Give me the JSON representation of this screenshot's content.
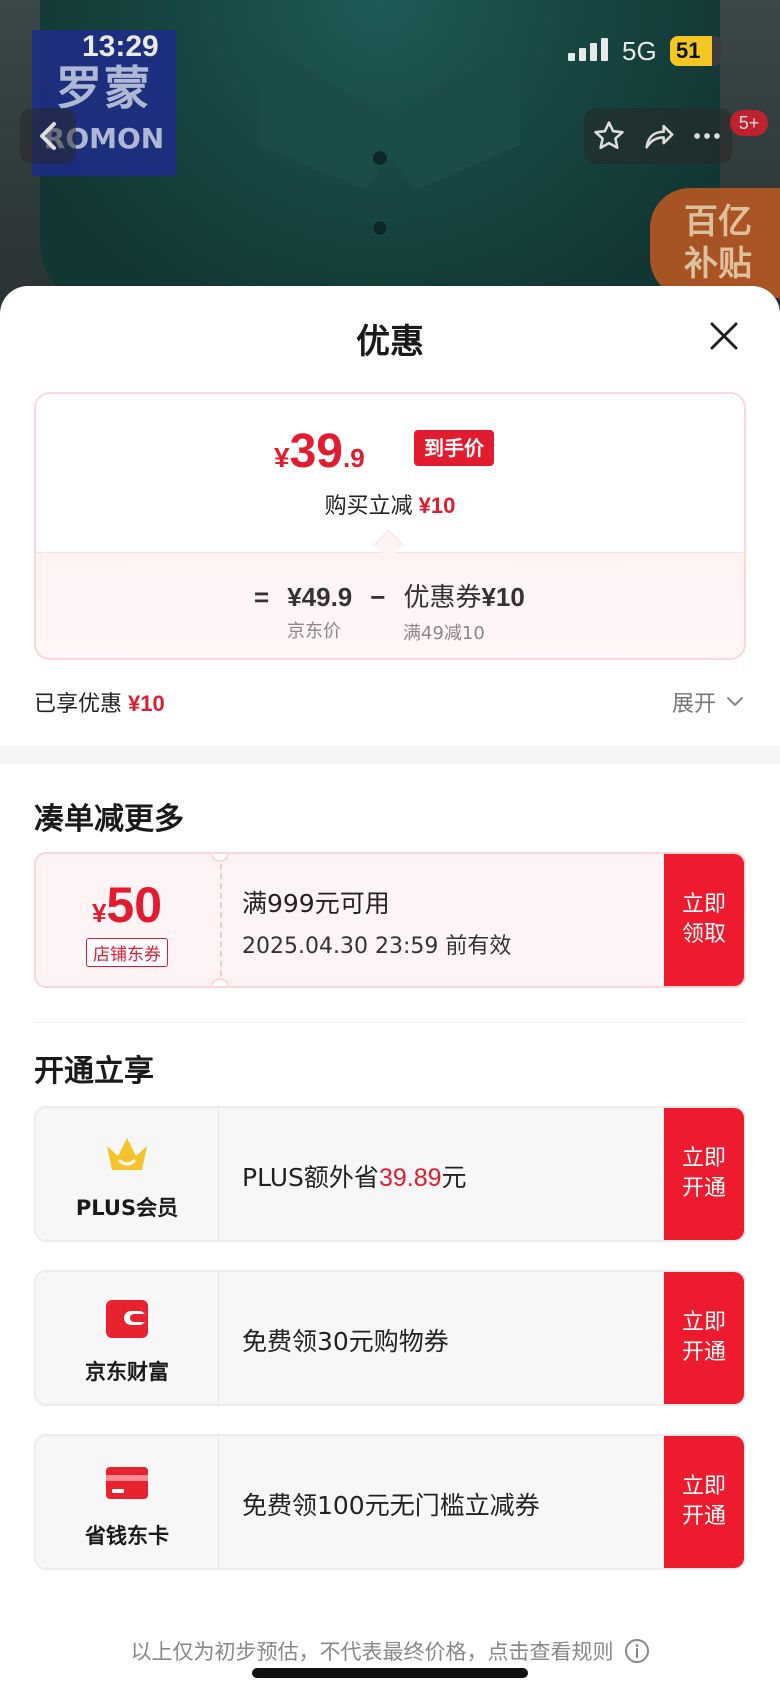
{
  "status_bar": {
    "time": "13:29",
    "network": "5G",
    "battery": "51"
  },
  "product_image": {
    "brand_cn": "罗蒙",
    "brand_en": "ROMON",
    "subsidy_badge": [
      "百亿",
      "补贴"
    ],
    "nav_badge": "5+"
  },
  "sheet": {
    "title": "优惠",
    "price": {
      "currency": "¥",
      "integer": "39",
      "decimal": ".9",
      "tag": "到手价"
    },
    "instant": {
      "text": "购买立减",
      "amount": "¥10"
    },
    "formula": {
      "equals": "=",
      "base_price": "¥49.9",
      "base_label": "京东价",
      "minus": "−",
      "coupon_label_text": "优惠券",
      "coupon_value": "¥10",
      "coupon_rule": "满49减10"
    },
    "enjoyed": {
      "text": "已享优惠",
      "amount": "¥10"
    },
    "expand_label": "展开"
  },
  "more_section": {
    "title": "凑单减更多",
    "coupon": {
      "currency": "¥",
      "amount": "50",
      "type": "店铺东券",
      "condition": "满999元可用",
      "expiry": "2025.04.30 23:59 前有效",
      "cta": [
        "立即",
        "领取"
      ]
    }
  },
  "open_section": {
    "title": "开通立享",
    "cards": [
      {
        "name": "PLUS会员",
        "desc_prefix": "PLUS额外省",
        "desc_highlight": "39.89",
        "desc_suffix": "元",
        "cta": [
          "立即",
          "开通"
        ],
        "icon": "crown-icon",
        "icon_color": "#f5c32c"
      },
      {
        "name": "京东财富",
        "desc_prefix": "免费领30元购物券",
        "desc_highlight": "",
        "desc_suffix": "",
        "cta": [
          "立即",
          "开通"
        ],
        "icon": "wallet-icon",
        "icon_color": "#e8232f"
      },
      {
        "name": "省钱东卡",
        "desc_prefix": "免费领100元无门槛立减券",
        "desc_highlight": "",
        "desc_suffix": "",
        "cta": [
          "立即",
          "开通"
        ],
        "icon": "card-icon",
        "icon_color": "#e8232f"
      }
    ]
  },
  "footer": {
    "note": "以上仅为初步预估，不代表最终价格，点击查看规则"
  },
  "colors": {
    "accent_red": "#e31b2e",
    "cta_red": "#ee1b2e"
  }
}
